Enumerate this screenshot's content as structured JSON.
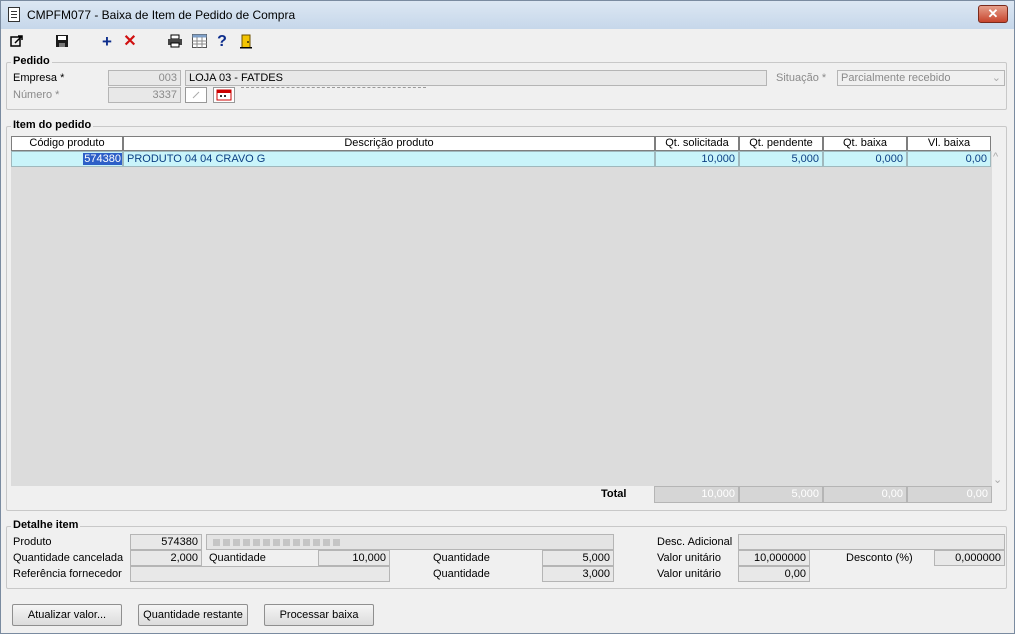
{
  "window": {
    "title": "CMPFM077 - Baixa de Item de Pedido de Compra",
    "close_label": "✕"
  },
  "toolbar": {
    "icons": [
      "export-icon",
      "save-icon",
      "add-icon",
      "delete-icon",
      "print-icon",
      "grid-icon",
      "help-icon",
      "exit-icon"
    ]
  },
  "pedido": {
    "group_title": "Pedido",
    "empresa_label": "Empresa *",
    "empresa_code": "003",
    "empresa_name": "LOJA 03 - FATDES",
    "numero_label": "Número *",
    "numero_value": "3337",
    "situacao_label": "Situação *",
    "situacao_value": "Parcialmente recebido"
  },
  "item_grid": {
    "group_title": "Item do pedido",
    "columns": [
      "Código produto",
      "Descrição produto",
      "Qt. solicitada",
      "Qt. pendente",
      "Qt. baixa",
      "Vl. baixa"
    ],
    "rows": [
      [
        "574380",
        "PRODUTO 04 04 CRAVO G",
        "10,000",
        "5,000",
        "0,000",
        "0,00"
      ]
    ],
    "total_label": "Total",
    "totals": [
      "10,000",
      "5,000",
      "0,00",
      "0,00"
    ]
  },
  "detalhe": {
    "group_title": "Detalhe item",
    "produto_label": "Produto",
    "produto_code": "574380",
    "qtd_cancelada_label": "Quantidade cancelada",
    "qtd_cancelada_value": "2,000",
    "quantidade_label": "Quantidade",
    "quantidade_value": "10,000",
    "quantidade2_label": "Quantidade",
    "quantidade2_value": "5,000",
    "ref_fornecedor_label": "Referência fornecedor",
    "quantidade3_label": "Quantidade",
    "quantidade3_value": "3,000",
    "desc_adicional_label": "Desc. Adicional",
    "valor_unitario_label": "Valor unitário",
    "valor_unitario_value": "10,000000",
    "desconto_label": "Desconto (%)",
    "desconto_value": "0,000000",
    "valor_unitario2_label": "Valor unitário",
    "valor_unitario2_value": "0,00"
  },
  "buttons": {
    "atualizar": "Atualizar valor...",
    "quantidade_restante": "Quantidade restante",
    "processar": "Processar baixa"
  }
}
